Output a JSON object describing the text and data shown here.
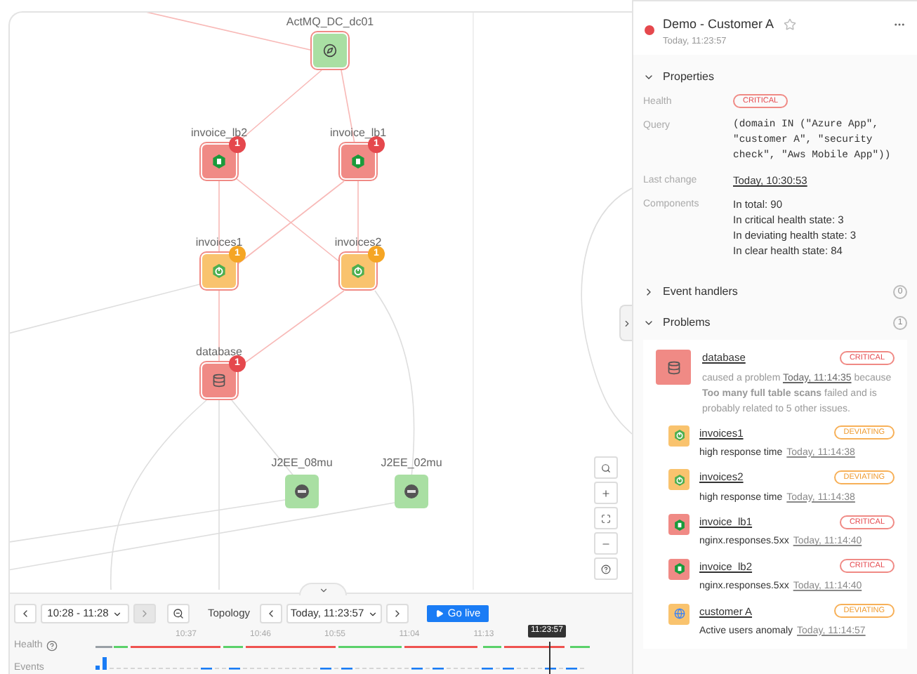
{
  "topology": {
    "nodes": [
      {
        "label": "ActMQ_DC_dc01",
        "kind": "compass",
        "color": "#a9dfa3",
        "highlighted": true
      },
      {
        "label": "invoice_lb2",
        "kind": "nginx",
        "color": "#f08a85",
        "highlighted": true,
        "badge": "1"
      },
      {
        "label": "invoice_lb1",
        "kind": "nginx",
        "color": "#f08a85",
        "highlighted": true,
        "badge": "1"
      },
      {
        "label": "invoices1",
        "kind": "power",
        "color": "#f9c36e",
        "highlighted": true,
        "badge": "1"
      },
      {
        "label": "invoices2",
        "kind": "power",
        "color": "#f9c36e",
        "highlighted": true,
        "badge": "1"
      },
      {
        "label": "database",
        "kind": "database",
        "color": "#f08a85",
        "highlighted": true,
        "badge": "1"
      },
      {
        "label": "J2EE_08mu",
        "kind": "disc",
        "color": "#a9dfa3",
        "highlighted": false
      },
      {
        "label": "J2EE_02mu",
        "kind": "disc",
        "color": "#a9dfa3",
        "highlighted": false
      }
    ]
  },
  "timeline": {
    "range": "10:28 - 11:28",
    "mode": "Topology",
    "time": "Today, 11:23:57",
    "go_live": "Go live",
    "health_label": "Health",
    "events_label": "Events",
    "ticks": [
      "10:37",
      "10:46",
      "10:55",
      "11:04",
      "11:13"
    ],
    "marker": "11:23:57"
  },
  "panel": {
    "title": "Demo - Customer A",
    "color": "#e5484d",
    "subtitle": "Today, 11:23:57",
    "properties": {
      "title": "Properties",
      "expanded": true,
      "rows": [
        {
          "label": "Health",
          "kind": "badge",
          "value": "CRITICAL",
          "color": "#e5484d"
        },
        {
          "label": "Query",
          "kind": "code",
          "value": "(domain IN (\"Azure App\", \"customer A\", \"security check\", \"Aws Mobile App\"))"
        },
        {
          "label": "Last change",
          "kind": "link",
          "value": "Today, 10:30:53"
        },
        {
          "label": "Components",
          "kind": "lines",
          "lines": [
            "In total: 90",
            "In critical health state: 3",
            "In deviating health state: 3",
            "In clear health state: 84"
          ]
        }
      ]
    },
    "event_handlers": {
      "title": "Event handlers",
      "count": "0",
      "expanded": false
    },
    "problems": {
      "title": "Problems",
      "count": "1",
      "expanded": true,
      "cause": {
        "name": "database",
        "kind": "database",
        "color": "#f08a85",
        "status": "CRITICAL",
        "intro": "caused a problem",
        "time": "Today, 11:14:35",
        "detail": "because **Too many full table scans** failed and is probably related to 5 other issues."
      },
      "items": [
        {
          "name": "invoices1",
          "kind": "power",
          "color": "#f9c36e",
          "status": "DEVIATING",
          "title": "high response time",
          "time": "Today, 11:14:38"
        },
        {
          "name": "invoices2",
          "kind": "power",
          "color": "#f9c36e",
          "status": "DEVIATING",
          "title": "high response time",
          "time": "Today, 11:14:38"
        },
        {
          "name": "invoice_lb1",
          "kind": "nginx",
          "color": "#f08a85",
          "status": "CRITICAL",
          "title": "nginx.responses.5xx",
          "time": "Today, 11:14:40"
        },
        {
          "name": "invoice_lb2",
          "kind": "nginx",
          "color": "#f08a85",
          "status": "CRITICAL",
          "title": "nginx.responses.5xx",
          "time": "Today, 11:14:40"
        },
        {
          "name": "customer A",
          "kind": "globe",
          "color": "#f9c36e",
          "status": "DEVIATING",
          "title": "Active users anomaly",
          "time": "Today, 11:14:57"
        }
      ]
    }
  }
}
